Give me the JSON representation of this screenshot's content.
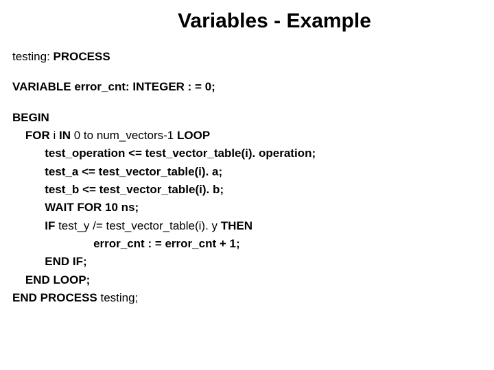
{
  "title": "Variables - Example",
  "code": {
    "l1a": "testing: ",
    "l1b": "PROCESS",
    "l2": "VARIABLE error_cnt: INTEGER : = 0;",
    "l3": "BEGIN",
    "l4a": "    FOR ",
    "l4b": "i ",
    "l4c": "IN ",
    "l4d": "0 to num_vectors-1 ",
    "l4e": "LOOP",
    "l5": "          test_operation <= test_vector_table(i). operation;",
    "l6": "          test_a <= test_vector_table(i). a;",
    "l7": "          test_b <= test_vector_table(i). b;",
    "l8": "          WAIT FOR 10 ns;",
    "l9a": "          IF ",
    "l9b": "test_y /= test_vector_table(i). y ",
    "l9c": "THEN",
    "l10": "                         error_cnt : = error_cnt + 1;",
    "l11": "          END IF;",
    "l12": "    END LOOP;",
    "l13a": "END PROCESS ",
    "l13b": "testing;"
  }
}
